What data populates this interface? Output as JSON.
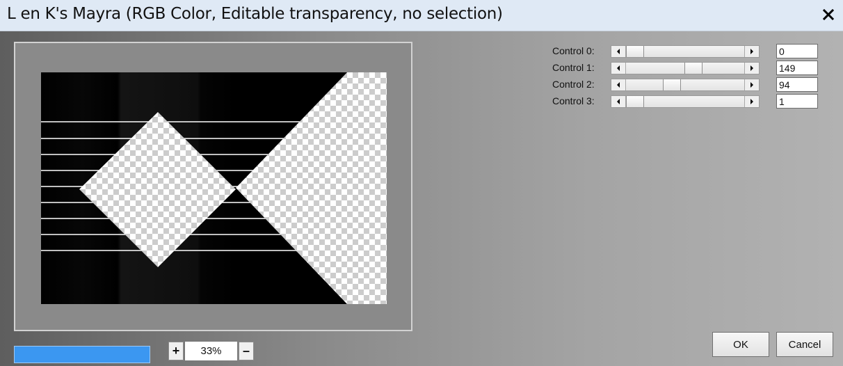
{
  "window": {
    "title": "L en K's Mayra  (RGB Color, Editable transparency, no selection)",
    "close_glyph": "✕"
  },
  "preview": {
    "zoom_in_label": "+",
    "zoom_value": "33%",
    "zoom_out_label": "–",
    "progress_color": "#3b97f1"
  },
  "controls": [
    {
      "label": "Control 0:",
      "value": "0",
      "position_fraction": 0.0
    },
    {
      "label": "Control 1:",
      "value": "149",
      "position_fraction": 0.58
    },
    {
      "label": "Control 2:",
      "value": "94",
      "position_fraction": 0.37
    },
    {
      "label": "Control 3:",
      "value": "1",
      "position_fraction": 0.0
    }
  ],
  "buttons": {
    "ok_label": "OK",
    "cancel_label": "Cancel"
  },
  "icons": {
    "close": "close-icon",
    "scroll_left": "arrow-left-icon",
    "scroll_right": "arrow-right-icon"
  }
}
